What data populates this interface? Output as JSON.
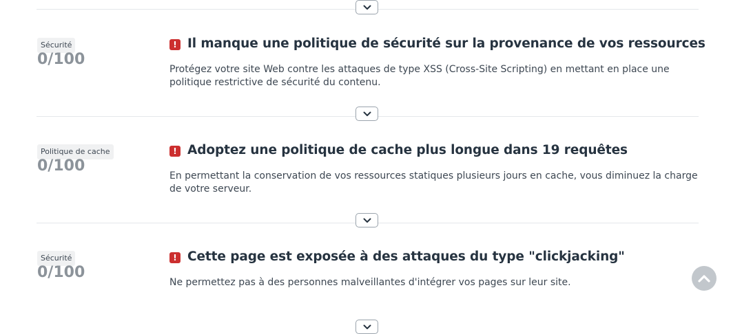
{
  "items": [
    {
      "tag": "Sécurité",
      "score": "0/100",
      "alert_icon": "exclamation-icon",
      "title": "Il manque une politique de sécurité sur la provenance de vos ressources",
      "description": "Protégez votre site Web contre les attaques de type XSS (Cross-Site Scripting) en mettant en place une politique restrictive de sécurité du contenu."
    },
    {
      "tag": "Politique de cache",
      "score": "0/100",
      "alert_icon": "exclamation-icon",
      "title": "Adoptez une politique de cache plus longue dans 19 requêtes",
      "description": "En permettant la conservation de vos ressources statiques plusieurs jours en cache, vous diminuez la charge de votre serveur."
    },
    {
      "tag": "Sécurité",
      "score": "0/100",
      "alert_icon": "exclamation-icon",
      "title": "Cette page est exposée à des attaques du type \"clickjacking\"",
      "description": "Ne permettez pas à des personnes malveillantes d'intégrer vos pages sur leur site."
    }
  ],
  "icons": {
    "expand": "chevron-down-icon",
    "scroll_top": "chevron-up-icon"
  },
  "colors": {
    "alert": "#cc2f2f",
    "title": "#263340",
    "score": "#8c939a",
    "scroll_button": "#c2c7cc"
  }
}
